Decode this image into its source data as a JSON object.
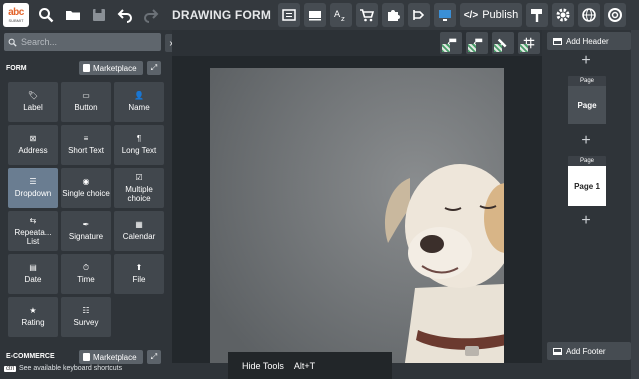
{
  "logo": {
    "big": "abc",
    "small": "SUBMIT"
  },
  "title": "DRAWING FORM",
  "publish_label": "Publish",
  "publish_icon": "</>",
  "toolbar_icons": [
    "search-icon",
    "folder-icon",
    "save-icon",
    "undo-icon",
    "redo-icon",
    "form-icon",
    "layout-icon",
    "translate-icon",
    "cart-icon",
    "puzzle-icon",
    "logic-icon",
    "preview-icon",
    "paint-icon",
    "gear-icon",
    "globe-icon",
    "help-icon"
  ],
  "search": {
    "placeholder": "Search..."
  },
  "collapse_glyph": "›",
  "sidebar": {
    "form_label": "FORM",
    "ecommerce_label": "E-COMMERCE",
    "marketplace": "Marketplace",
    "expand_glyph": "⤢",
    "items": [
      {
        "label": "Label",
        "icon": "🏷"
      },
      {
        "label": "Button",
        "icon": "▭"
      },
      {
        "label": "Name",
        "icon": "👤"
      },
      {
        "label": "Address",
        "icon": "⊠"
      },
      {
        "label": "Short Text",
        "icon": "≡"
      },
      {
        "label": "Long Text",
        "icon": "¶"
      },
      {
        "label": "Dropdown",
        "icon": "☰"
      },
      {
        "label": "Single choice",
        "icon": "◉"
      },
      {
        "label": "Multiple choice",
        "icon": "☑"
      },
      {
        "label": "Repeata... List",
        "icon": "⇆"
      },
      {
        "label": "Signature",
        "icon": "✒"
      },
      {
        "label": "Calendar",
        "icon": "▦"
      },
      {
        "label": "Date",
        "icon": "▤"
      },
      {
        "label": "Time",
        "icon": "⏱"
      },
      {
        "label": "File",
        "icon": "⬆"
      },
      {
        "label": "Rating",
        "icon": "★"
      },
      {
        "label": "Survey",
        "icon": "☷"
      }
    ],
    "active_item": "Dropdown"
  },
  "shortcut": {
    "kbd": "ctrl",
    "text": "See available keyboard shortcuts"
  },
  "drawing_tools": [
    "draw-line-tool-icon",
    "draw-pen-tool-icon",
    "draw-edit-tool-icon",
    "grid-tool-icon"
  ],
  "hide_tools": {
    "label": "Hide Tools",
    "shortcut": "Alt+T"
  },
  "right_panel": {
    "add_header": "Add Header",
    "add_footer": "Add Footer",
    "plus": "+",
    "pages": [
      {
        "title": "Page",
        "body": "Page"
      },
      {
        "title": "Page",
        "body": "Page 1"
      }
    ]
  }
}
